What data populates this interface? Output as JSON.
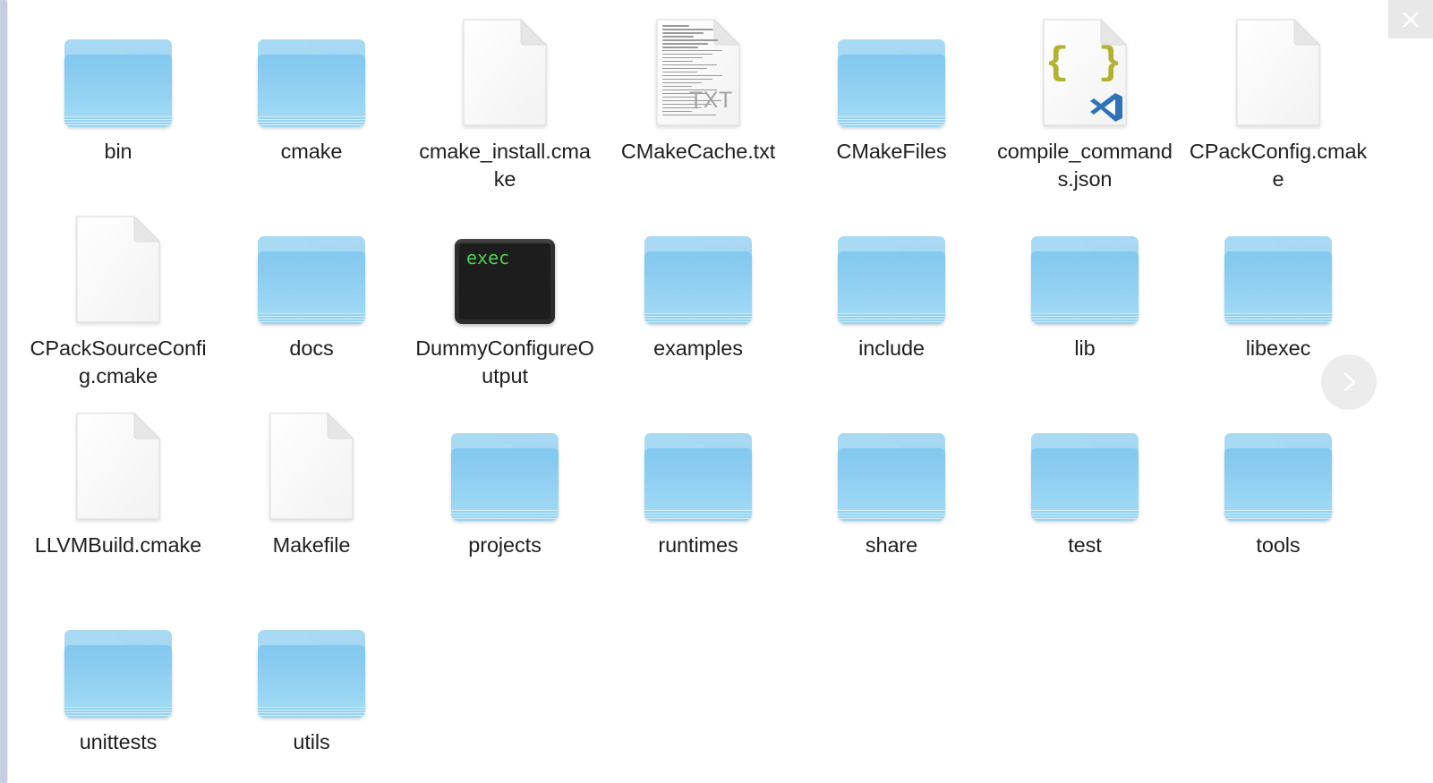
{
  "window": {
    "background_color": "#ffffff",
    "close_button": {
      "label": "Close",
      "icon": "close-icon",
      "background": "#e8e8e8",
      "glyph_color": "#ffffff"
    },
    "next_button": {
      "label": "Next page",
      "icon": "chevron-right-icon",
      "background": "#ececec",
      "glyph_color": "#ffffff"
    },
    "scrollbar": {
      "orientation": "vertical",
      "position": "left",
      "track_color": "#dde4ee",
      "thumb_color": "#c3cfe1"
    }
  },
  "grid": {
    "columns": 7,
    "rows": 4,
    "label_color": "#1f1f1f",
    "folder_color": "#8ccdf0",
    "document_color": "#ffffff",
    "json_brace_color": "#b2b232",
    "vscode_badge_color": "#2f72b8",
    "terminal_background": "#1d1d1d",
    "terminal_text_color": "#4fd04f",
    "items": [
      {
        "name": "bin",
        "type": "folder",
        "row": 0,
        "col": 0
      },
      {
        "name": "cmake",
        "type": "folder",
        "row": 0,
        "col": 1
      },
      {
        "name": "cmake_install.cmake",
        "type": "document",
        "row": 0,
        "col": 2
      },
      {
        "name": "CMakeCache.txt",
        "type": "text",
        "row": 0,
        "col": 3,
        "badge": "TXT"
      },
      {
        "name": "CMakeFiles",
        "type": "folder",
        "row": 0,
        "col": 4
      },
      {
        "name": "compile_commands.json",
        "type": "json",
        "row": 0,
        "col": 5,
        "braces": "{ }",
        "overlay": "vscode-badge"
      },
      {
        "name": "CPackConfig.cmake",
        "type": "document",
        "row": 0,
        "col": 6
      },
      {
        "name": "CPackSourceConfig.cmake",
        "type": "document",
        "row": 1,
        "col": 0
      },
      {
        "name": "docs",
        "type": "folder",
        "row": 1,
        "col": 1
      },
      {
        "name": "DummyConfigureOutput",
        "type": "exec",
        "row": 1,
        "col": 2,
        "terminal_text": "exec"
      },
      {
        "name": "examples",
        "type": "folder",
        "row": 1,
        "col": 3
      },
      {
        "name": "include",
        "type": "folder",
        "row": 1,
        "col": 4
      },
      {
        "name": "lib",
        "type": "folder",
        "row": 1,
        "col": 5
      },
      {
        "name": "libexec",
        "type": "folder",
        "row": 1,
        "col": 6
      },
      {
        "name": "LLVMBuild.cmake",
        "type": "document",
        "row": 2,
        "col": 0
      },
      {
        "name": "Makefile",
        "type": "document",
        "row": 2,
        "col": 1
      },
      {
        "name": "projects",
        "type": "folder",
        "row": 2,
        "col": 2
      },
      {
        "name": "runtimes",
        "type": "folder",
        "row": 2,
        "col": 3
      },
      {
        "name": "share",
        "type": "folder",
        "row": 2,
        "col": 4
      },
      {
        "name": "test",
        "type": "folder",
        "row": 2,
        "col": 5
      },
      {
        "name": "tools",
        "type": "folder",
        "row": 2,
        "col": 6
      },
      {
        "name": "unittests",
        "type": "folder",
        "row": 3,
        "col": 0
      },
      {
        "name": "utils",
        "type": "folder",
        "row": 3,
        "col": 1
      }
    ]
  }
}
